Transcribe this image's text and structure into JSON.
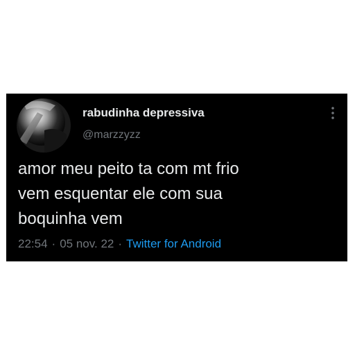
{
  "tweet": {
    "author": {
      "display_name": "rabudinha depressiva",
      "handle": "@marzzyzz"
    },
    "text_lines": [
      "amor meu peito ta com mt frio",
      "vem esquentar ele com sua",
      "boquinha vem"
    ],
    "meta": {
      "time": "22:54",
      "separator": "·",
      "date": "05 nov. 22",
      "source": "Twitter for Android"
    },
    "more_icon": "more-vertical-icon"
  },
  "colors": {
    "card_background": "#000000",
    "page_background": "#ffffff",
    "primary_text": "#e7e9ea",
    "secondary_text": "#71767b",
    "link": "#1d9bf0"
  }
}
